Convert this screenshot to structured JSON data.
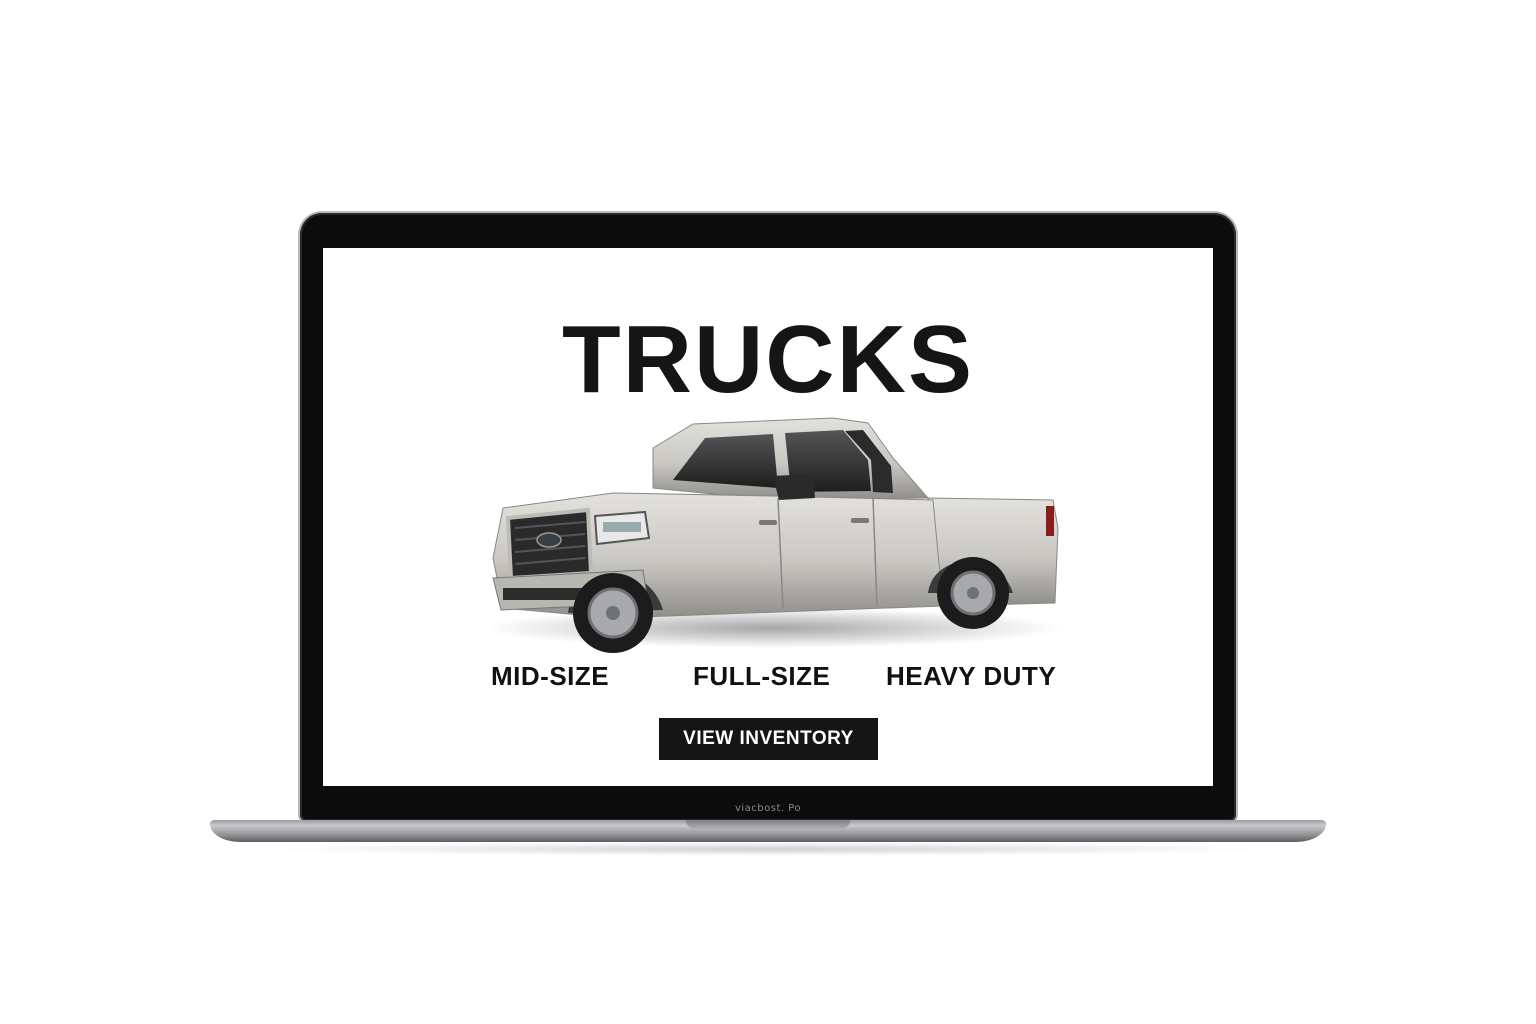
{
  "page": {
    "title": "TRUCKS",
    "categories": [
      {
        "label": "MID-SIZE"
      },
      {
        "label": "FULL-SIZE"
      },
      {
        "label": "HEAVY DUTY"
      }
    ],
    "cta_label": "VIEW INVENTORY",
    "hero_image": "pickup-truck"
  },
  "device": {
    "bezel_label": "viacbost. Po"
  },
  "colors": {
    "text": "#151515",
    "button_bg": "#151515",
    "button_text": "#ffffff",
    "truck_body": "#c9c7c2"
  }
}
